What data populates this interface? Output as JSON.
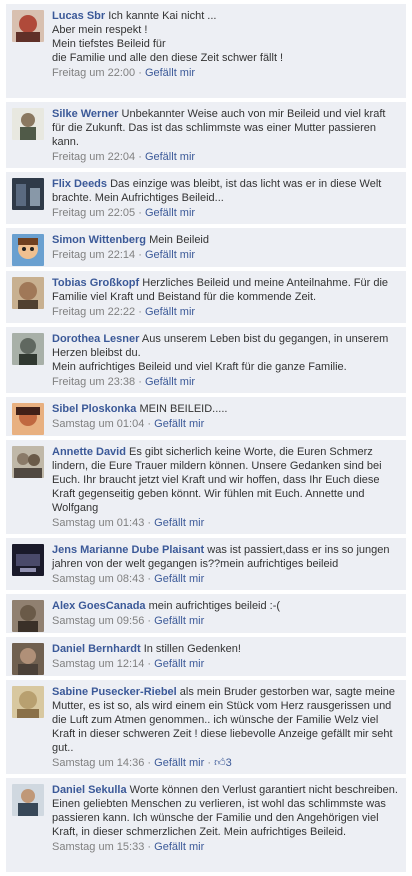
{
  "comments": [
    {
      "author": "Lucas Sbr",
      "text": "Ich kannte Kai nicht ...\nAber mein respekt !\nMein tiefstes Beileid für\ndie Familie und alle den diese Zeit schwer fällt !",
      "time": "Freitag um 22:00",
      "like": "Gefällt mir",
      "avatar_color": "#b04a3a"
    },
    {
      "author": "Silke Werner",
      "text": "Unbekannter Weise auch von mir Beileid und viel kraft für die Zukunft. Das ist das schlimmste was einer Mutter passieren kann.",
      "time": "Freitag um 22:04",
      "like": "Gefällt mir",
      "avatar_color": "#c8c8c0"
    },
    {
      "author": "Flix Deeds",
      "text": "Das einzige was bleibt, ist das licht was er in diese Welt brachte. Mein Aufrichtiges Beileid...",
      "time": "Freitag um 22:05",
      "like": "Gefällt mir",
      "avatar_color": "#2f3a48"
    },
    {
      "author": "Simon Wittenberg",
      "text": "Mein Beileid",
      "time": "Freitag um 22:14",
      "like": "Gefällt mir",
      "avatar_color": "#e0a060"
    },
    {
      "author": "Tobias Großkopf",
      "text": "Herzliches Beileid und meine Anteilnahme. Für die Familie viel Kraft und Beistand für die kommende Zeit.",
      "time": "Freitag um 22:22",
      "like": "Gefällt mir",
      "avatar_color": "#a07858"
    },
    {
      "author": "Dorothea Lesner",
      "text": "Aus unserem Leben bist du gegangen, in unserem Herzen bleibst du.\nMein aufrichtiges Beileid und viel Kraft für die ganze Familie.",
      "time": "Freitag um 23:38",
      "like": "Gefällt mir",
      "avatar_color": "#606860"
    },
    {
      "author": "Sibel Ploskonka",
      "text": "MEIN BEILEID.....",
      "time": "Samstag um 01:04",
      "like": "Gefällt mir",
      "avatar_color": "#c06840"
    },
    {
      "author": "Annette David",
      "text": "Es gibt sicherlich keine Worte, die Euren Schmerz lindern, die Eure Trauer mildern können. Unsere Gedanken sind bei Euch. Ihr braucht jetzt viel Kraft und wir hoffen, dass Ihr Euch diese Kraft gegenseitig geben könnt. Wir fühlen mit Euch. Annette und Wolfgang",
      "time": "Samstag um 01:43",
      "like": "Gefällt mir",
      "avatar_color": "#8a7a68"
    },
    {
      "author": "Jens Marianne Dube Plaisant",
      "text": "was ist passiert,dass er ins so jungen jahren von der welt gegangen is??mein aufrichtiges beileid",
      "time": "Samstag um 08:43",
      "like": "Gefällt mir",
      "avatar_color": "#1a1a2a"
    },
    {
      "author": "Alex GoesCanada",
      "text": "mein aufrichtiges beileid :-(",
      "time": "Samstag um 09:56",
      "like": "Gefällt mir",
      "avatar_color": "#6a5a48"
    },
    {
      "author": "Daniel Bernhardt",
      "text": "In stillen Gedenken!",
      "time": "Samstag um 12:14",
      "like": "Gefällt mir",
      "avatar_color": "#4a4038"
    },
    {
      "author": "Sabine Pusecker-Riebel",
      "text": "als mein Bruder gestorben war, sagte meine Mutter, es ist so, als wird einem ein Stück vom Herz rausgerissen und die Luft zum Atmen genommen.. ich wünsche der Familie Welz viel Kraft in dieser schweren Zeit ! diese liebevolle Anzeige gefällt mir seht gut..",
      "time": "Samstag um 14:36",
      "like": "Gefällt mir",
      "likes_count": "3",
      "avatar_color": "#b8a070"
    },
    {
      "author": "Daniel Sekulla",
      "text": "Worte können den Verlust garantiert nicht beschreiben. Einen geliebten Menschen zu verlieren, ist wohl das schlimmste was passieren kann. Ich wünsche der Familie und den Angehörigen viel Kraft, in dieser schmerzlichen Zeit. Mein aufrichtiges Beileid.",
      "time": "Samstag um 15:33",
      "like": "Gefällt mir",
      "avatar_color": "#384858"
    }
  ]
}
